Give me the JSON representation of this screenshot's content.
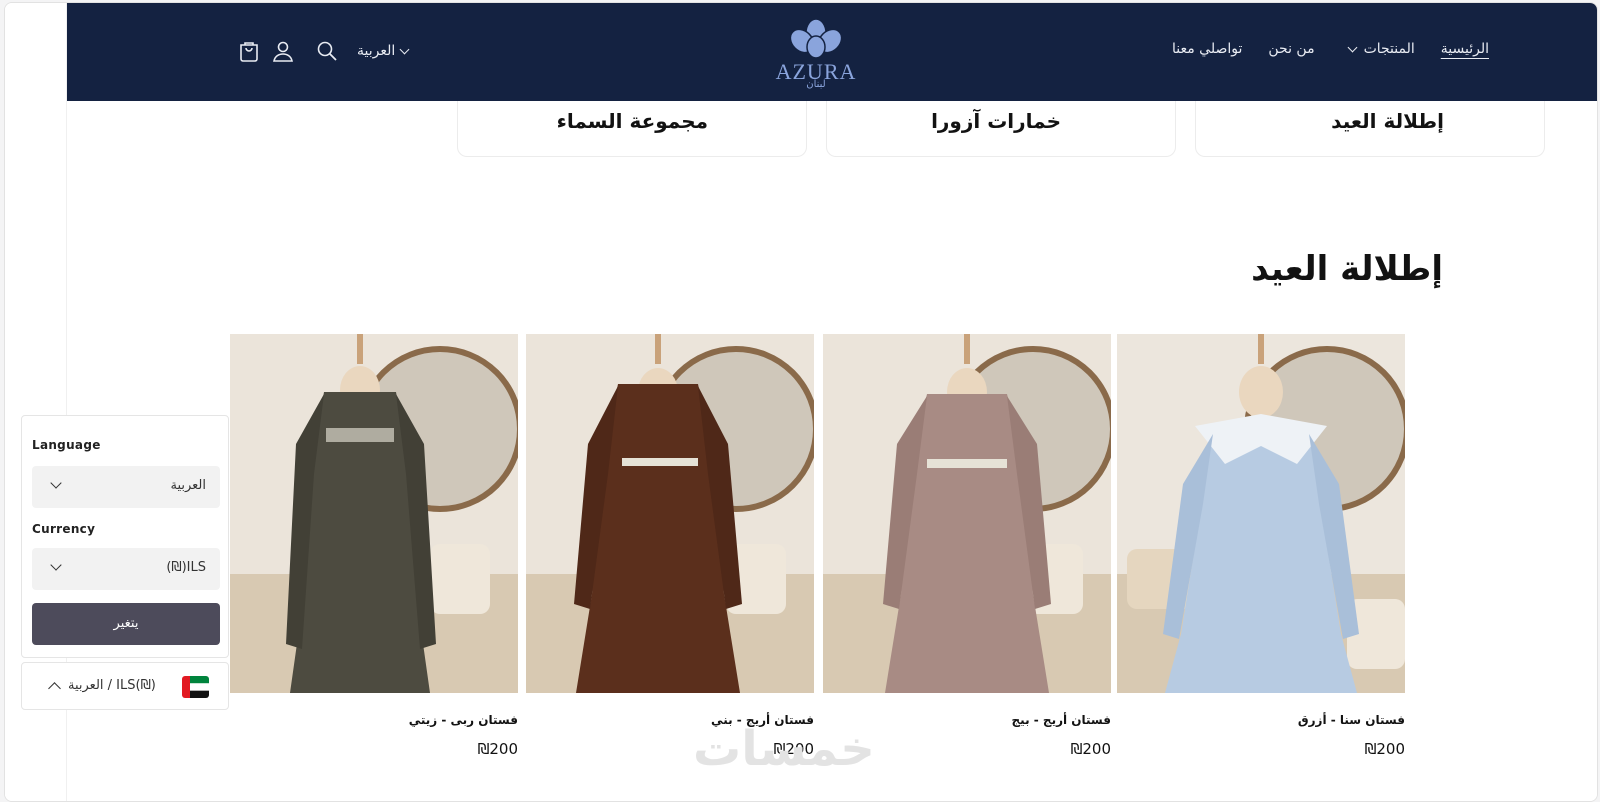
{
  "header": {
    "nav": [
      {
        "label": "الرئيسية",
        "active": true
      },
      {
        "label": "المنتجات",
        "has_dropdown": true
      },
      {
        "label": "من نحن"
      },
      {
        "label": "تواصلي معنا"
      }
    ],
    "logo_text": "AZURA",
    "logo_subtext": "لبنان",
    "language_toggle": "العربية",
    "icons": [
      "cart-icon",
      "account-icon",
      "search-icon"
    ],
    "background_color": "#142241"
  },
  "collections": [
    {
      "title": "إطلالة العيد"
    },
    {
      "title": "خمارات آزورا"
    },
    {
      "title": "مجموعة السماء"
    }
  ],
  "section": {
    "title": "إطلالة العيد"
  },
  "products": [
    {
      "name": "فستان سنا - أزرق",
      "price": "₪200",
      "color": "#b7cbe2"
    },
    {
      "name": "فستان أريج - بيج",
      "price": "₪200",
      "color": "#a88b84"
    },
    {
      "name": "فستان أريج - بني",
      "price": "₪200",
      "color": "#5b2f1c"
    },
    {
      "name": "فستان ربى - زيتي",
      "price": "₪200",
      "color": "#4d4b40"
    }
  ],
  "localization": {
    "language_label": "Language",
    "language_value": "العربية",
    "currency_label": "Currency",
    "currency_value": "ILS(₪)",
    "apply_label": "يتغير",
    "summary": "العربية  /  ILS(₪)"
  },
  "watermark": "خمسات"
}
